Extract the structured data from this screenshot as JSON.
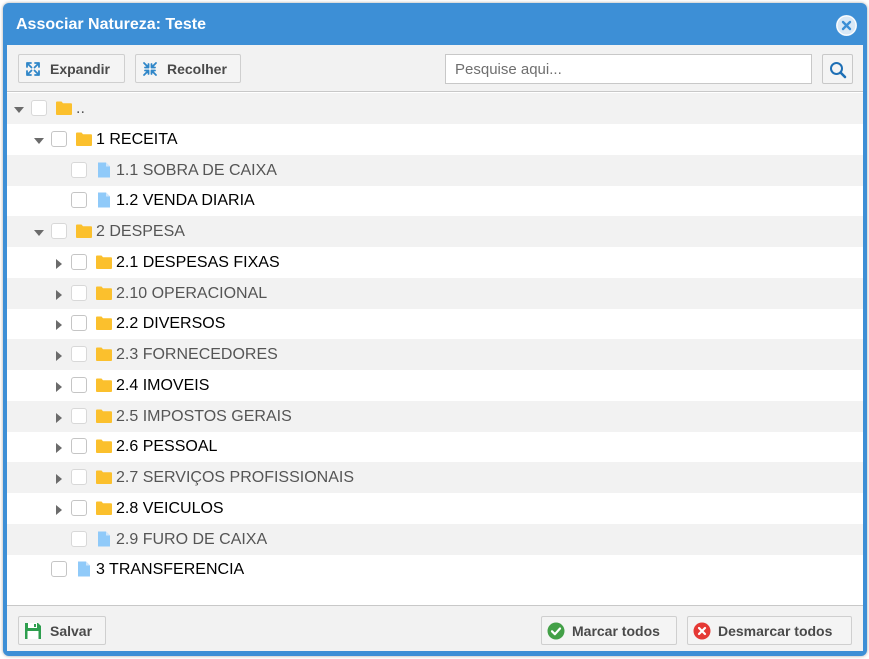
{
  "dialog": {
    "title": "Associar Natureza: Teste"
  },
  "toolbar": {
    "expand_label": "Expandir",
    "collapse_label": "Recolher",
    "search_placeholder": "Pesquise aqui..."
  },
  "tree": {
    "nodes": [
      {
        "label": "..",
        "depth": 0,
        "kind": "folder",
        "expanded": true
      },
      {
        "label": "1 RECEITA",
        "depth": 1,
        "kind": "folder",
        "expanded": true
      },
      {
        "label": "1.1 SOBRA DE CAIXA",
        "depth": 2,
        "kind": "file"
      },
      {
        "label": "1.2 VENDA DIARIA",
        "depth": 2,
        "kind": "file"
      },
      {
        "label": "2 DESPESA",
        "depth": 1,
        "kind": "folder",
        "expanded": true
      },
      {
        "label": "2.1 DESPESAS FIXAS",
        "depth": 2,
        "kind": "folder",
        "expanded": false
      },
      {
        "label": "2.10 OPERACIONAL",
        "depth": 2,
        "kind": "folder",
        "expanded": false
      },
      {
        "label": "2.2 DIVERSOS",
        "depth": 2,
        "kind": "folder",
        "expanded": false
      },
      {
        "label": "2.3 FORNECEDORES",
        "depth": 2,
        "kind": "folder",
        "expanded": false
      },
      {
        "label": "2.4 IMOVEIS",
        "depth": 2,
        "kind": "folder",
        "expanded": false
      },
      {
        "label": "2.5 IMPOSTOS GERAIS",
        "depth": 2,
        "kind": "folder",
        "expanded": false
      },
      {
        "label": "2.6 PESSOAL",
        "depth": 2,
        "kind": "folder",
        "expanded": false
      },
      {
        "label": "2.7 SERVIÇOS PROFISSIONAIS",
        "depth": 2,
        "kind": "folder",
        "expanded": false
      },
      {
        "label": "2.8 VEICULOS",
        "depth": 2,
        "kind": "folder",
        "expanded": false
      },
      {
        "label": "2.9 FURO DE CAIXA",
        "depth": 2,
        "kind": "file"
      },
      {
        "label": "3 TRANSFERENCIA",
        "depth": 1,
        "kind": "file"
      }
    ]
  },
  "footer": {
    "save_label": "Salvar",
    "check_all_label": "Marcar todos",
    "uncheck_all_label": "Desmarcar todos"
  },
  "icons": {
    "close": "close-icon",
    "expand": "expand-arrows-icon",
    "collapse": "collapse-arrows-icon",
    "search": "search-icon",
    "folder": "folder-icon",
    "file": "file-icon",
    "save": "floppy-disk-icon",
    "check": "check-circle-icon",
    "uncheck": "x-circle-icon"
  },
  "colors": {
    "header": "#3d8fd6",
    "folder": "#fbc02d",
    "file": "#90caf9",
    "check": "#43a047",
    "uncheck": "#e53935",
    "save": "#2e9e4e"
  }
}
